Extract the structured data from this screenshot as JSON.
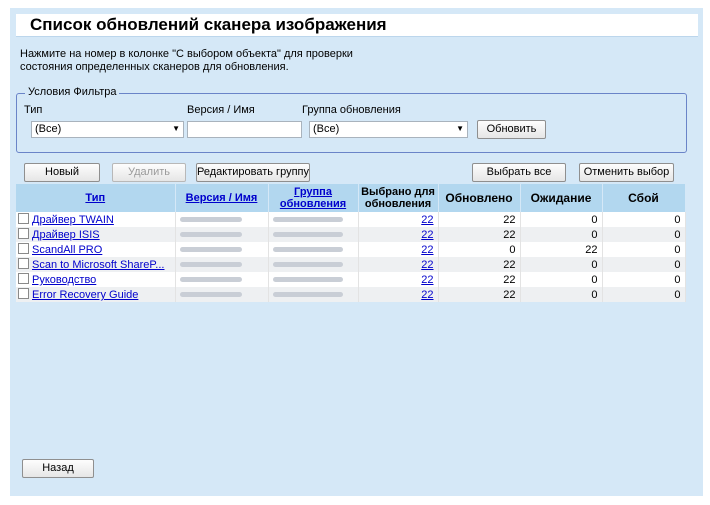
{
  "title": "Список обновлений сканера изображения",
  "description": [
    "Нажмите на номер в колонке \"С выбором объекта\" для проверки",
    "состояния определенных сканеров для обновления."
  ],
  "filter": {
    "legend": "Условия Фильтра",
    "type_label": "Тип",
    "version_label": "Версия / Имя",
    "group_label": "Группа обновления",
    "type_value": "(Все)",
    "version_value": "",
    "group_value": "(Все)",
    "refresh_button": "Обновить"
  },
  "toolbar": {
    "new_button": "Новый",
    "delete_button": "Удалить",
    "edit_group_button": "Редактировать группу",
    "select_all_button": "Выбрать все",
    "deselect_button": "Отменить выбор"
  },
  "table": {
    "columns": {
      "type": "Тип",
      "version": "Версия / Имя",
      "group": "Группа обновления",
      "selected": "Выбрано для обновления",
      "updated": "Обновлено",
      "waiting": "Ожидание",
      "failed": "Сбой"
    },
    "rows": [
      {
        "type": "Драйвер TWAIN",
        "selected": "22",
        "updated": "22",
        "waiting": "0",
        "failed": "0"
      },
      {
        "type": "Драйвер ISIS",
        "selected": "22",
        "updated": "22",
        "waiting": "0",
        "failed": "0"
      },
      {
        "type": "ScandAll PRO",
        "selected": "22",
        "updated": "0",
        "waiting": "22",
        "failed": "0"
      },
      {
        "type": "Scan to Microsoft ShareP...",
        "selected": "22",
        "updated": "22",
        "waiting": "0",
        "failed": "0"
      },
      {
        "type": "Руководство",
        "selected": "22",
        "updated": "22",
        "waiting": "0",
        "failed": "0"
      },
      {
        "type": "Error Recovery Guide",
        "selected": "22",
        "updated": "22",
        "waiting": "0",
        "failed": "0"
      }
    ]
  },
  "back_button": "Назад",
  "colors": {
    "panel_background": "#d5e8f7",
    "header_background": "#b2d7ef",
    "link": "#0000cc",
    "filter_border": "#6a84c8"
  }
}
